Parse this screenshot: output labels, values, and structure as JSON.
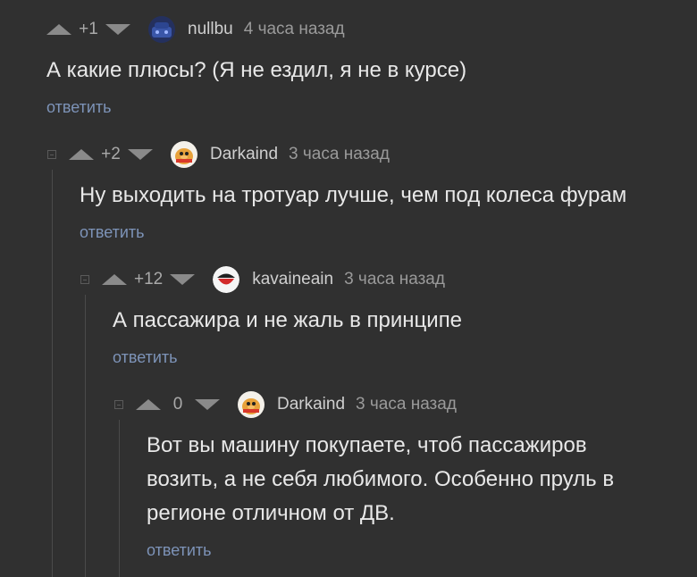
{
  "comments": [
    {
      "rating": "+1",
      "username": "nullbu",
      "time": "4 часа назад",
      "text": [
        "А какие плюсы? (Я не ездил, я не в курсе)"
      ],
      "reply": "ответить",
      "avatar_icon": "avatar-blue-icon"
    },
    {
      "rating": "+2",
      "username": "Darkaind",
      "time": "3 часа назад",
      "text": [
        "Ну выходить на тротуар лучше, чем под колеса фурам"
      ],
      "reply": "ответить",
      "avatar_icon": "avatar-duck-icon"
    },
    {
      "rating": "+12",
      "username": "kavaineain",
      "time": "3 часа назад",
      "text": [
        "А пассажира и не жаль в принципе"
      ],
      "reply": "ответить",
      "avatar_icon": "avatar-mouth-icon"
    },
    {
      "rating": "0",
      "username": "Darkaind",
      "time": "3 часа назад",
      "text": [
        "Вот вы машину покупаете, чтоб пассажиров",
        "возить, а не себя любимого. Особенно пруль в",
        "регионе отличном от ДВ."
      ],
      "reply": "ответить",
      "avatar_icon": "avatar-duck-icon"
    }
  ],
  "colors": {
    "background": "#303030",
    "text": "#e8e8e8",
    "meta": "#9a9a9a",
    "reply_link": "#7d93b8",
    "vote_arrow": "#8a8a8a"
  }
}
